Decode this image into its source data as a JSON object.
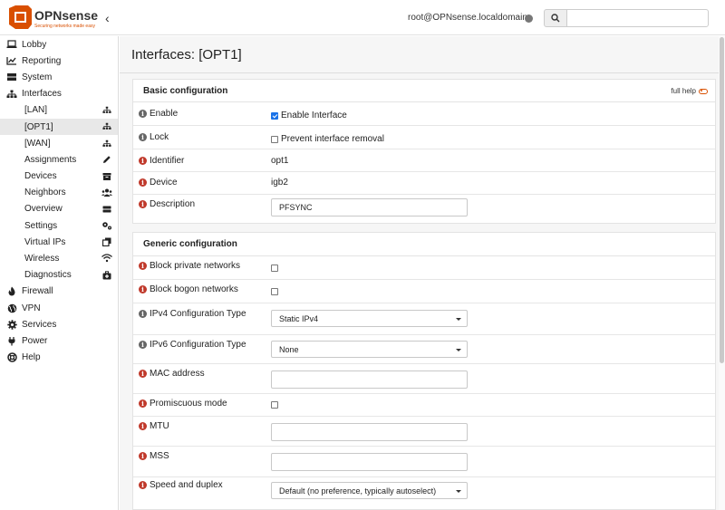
{
  "header": {
    "logo_text": "OPNsense",
    "logo_tagline": "Securing networks made easy",
    "user": "root@OPNsense.localdomain",
    "search_placeholder": ""
  },
  "sidebar": {
    "items": [
      {
        "label": "Lobby",
        "icon": "laptop-icon"
      },
      {
        "label": "Reporting",
        "icon": "chart-icon"
      },
      {
        "label": "System",
        "icon": "server-icon"
      },
      {
        "label": "Interfaces",
        "icon": "sitemap-icon"
      },
      {
        "label": "Firewall",
        "icon": "fire-icon"
      },
      {
        "label": "VPN",
        "icon": "globe-icon"
      },
      {
        "label": "Services",
        "icon": "cog-icon"
      },
      {
        "label": "Power",
        "icon": "plug-icon"
      },
      {
        "label": "Help",
        "icon": "lifebuoy-icon"
      }
    ],
    "interfaces_sub": [
      {
        "label": "[LAN]",
        "icon": "sitemap-icon"
      },
      {
        "label": "[OPT1]",
        "icon": "sitemap-icon"
      },
      {
        "label": "[WAN]",
        "icon": "sitemap-icon"
      },
      {
        "label": "Assignments",
        "icon": "pencil-icon"
      },
      {
        "label": "Devices",
        "icon": "archive-icon"
      },
      {
        "label": "Neighbors",
        "icon": "users-icon"
      },
      {
        "label": "Overview",
        "icon": "tasks-icon"
      },
      {
        "label": "Settings",
        "icon": "cogs-icon"
      },
      {
        "label": "Virtual IPs",
        "icon": "clone-icon"
      },
      {
        "label": "Wireless",
        "icon": "wifi-icon"
      },
      {
        "label": "Diagnostics",
        "icon": "medkit-icon"
      }
    ]
  },
  "main": {
    "title": "Interfaces: [OPT1]",
    "basic": {
      "heading": "Basic configuration",
      "full_help": "full help",
      "enable_label": "Enable",
      "enable_text": "Enable Interface",
      "lock_label": "Lock",
      "lock_text": "Prevent interface removal",
      "identifier_label": "Identifier",
      "identifier_value": "opt1",
      "device_label": "Device",
      "device_value": "igb2",
      "description_label": "Description",
      "description_value": "PFSYNC"
    },
    "generic": {
      "heading": "Generic configuration",
      "block_private_label": "Block private networks",
      "block_bogon_label": "Block bogon networks",
      "ipv4_label": "IPv4 Configuration Type",
      "ipv4_value": "Static IPv4",
      "ipv6_label": "IPv6 Configuration Type",
      "ipv6_value": "None",
      "mac_label": "MAC address",
      "mac_value": "",
      "promisc_label": "Promiscuous mode",
      "mtu_label": "MTU",
      "mtu_value": "",
      "mss_label": "MSS",
      "mss_value": "",
      "speed_label": "Speed and duplex",
      "speed_value": "Default (no preference, typically autoselect)"
    }
  },
  "colors": {
    "brand": "#d94f00",
    "info_red": "#c0392b",
    "info_gray": "#666666",
    "checkbox_checked": "#1a73e8"
  }
}
